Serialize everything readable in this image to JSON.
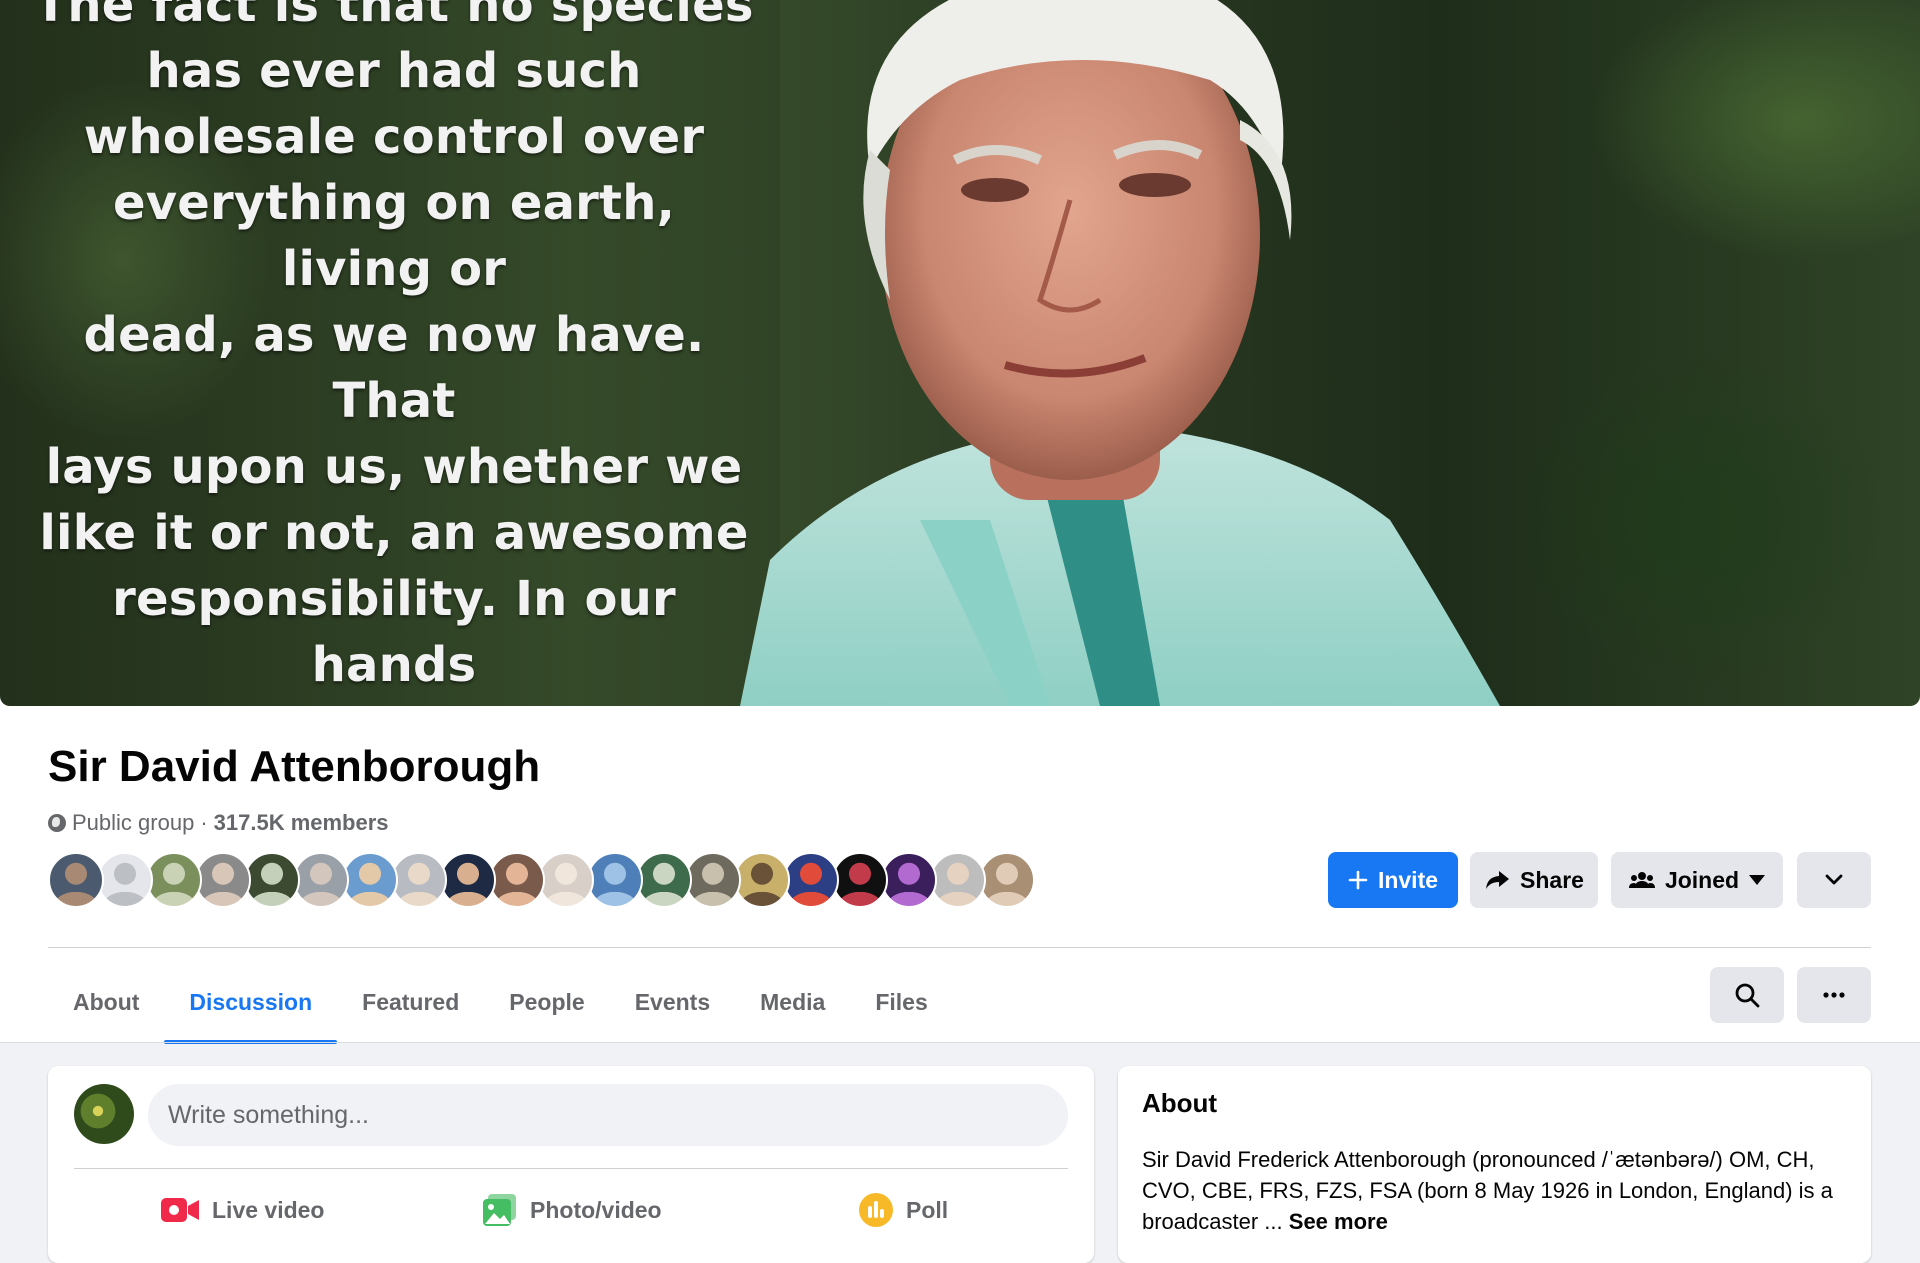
{
  "cover": {
    "quote": "The fact is that no species\nhas ever had such\nwholesale control over\neverything on earth, living or\ndead, as we now have. That\nlays upon us, whether we\nlike it or not, an awesome\nresponsibility. In our hands\nnow lies not only our own\nfuture, but that of all other\nliving creatures with whom\nwe share the earth.\""
  },
  "group": {
    "name": "Sir David Attenborough",
    "privacy": "Public group",
    "separator": "·",
    "members": "317.5K members"
  },
  "member_avatars": [
    {
      "color_a": "#4b5a6e",
      "color_b": "#a88a74"
    },
    {
      "color_a": "#e4e6eb",
      "color_b": "#bcc0c4"
    },
    {
      "color_a": "#7b8f5c",
      "color_b": "#c9d2b4"
    },
    {
      "color_a": "#8a8a8a",
      "color_b": "#d8c7b8"
    },
    {
      "color_a": "#3d4a32",
      "color_b": "#c5d0bb"
    },
    {
      "color_a": "#9aa0a8",
      "color_b": "#d3c6bc"
    },
    {
      "color_a": "#6b9ccf",
      "color_b": "#e3c9a8"
    },
    {
      "color_a": "#b8bcc2",
      "color_b": "#e8d9c8"
    },
    {
      "color_a": "#1e2a44",
      "color_b": "#d8b090"
    },
    {
      "color_a": "#7a5a4a",
      "color_b": "#e3b596"
    },
    {
      "color_a": "#d8d0c8",
      "color_b": "#f0e6dc"
    },
    {
      "color_a": "#4f7fb8",
      "color_b": "#9ec1e6"
    },
    {
      "color_a": "#3e6b4b",
      "color_b": "#cbd6c2"
    },
    {
      "color_a": "#6e6a5e",
      "color_b": "#c8c0ac"
    },
    {
      "color_a": "#c8b06a",
      "color_b": "#6a5238"
    },
    {
      "color_a": "#2c3e84",
      "color_b": "#e04b3a"
    },
    {
      "color_a": "#101010",
      "color_b": "#c23b4b"
    },
    {
      "color_a": "#3a1f5c",
      "color_b": "#b26ad0"
    },
    {
      "color_a": "#bdbdbd",
      "color_b": "#e6d2c0"
    },
    {
      "color_a": "#a98f74",
      "color_b": "#dfcbb6"
    }
  ],
  "actions": {
    "invite": "Invite",
    "share": "Share",
    "joined": "Joined"
  },
  "tabs": [
    "About",
    "Discussion",
    "Featured",
    "People",
    "Events",
    "Media",
    "Files"
  ],
  "active_tab": "Discussion",
  "composer": {
    "placeholder": "Write something...",
    "live_video": "Live video",
    "photo_video": "Photo/video",
    "poll": "Poll"
  },
  "about": {
    "title": "About",
    "description": "Sir David Frederick Attenborough (pronounced /ˈætənbərə/) OM, CH, CVO, CBE, FRS, FZS, FSA (born 8 May 1926 in London, England) is a broadcaster ...",
    "see_more": "See more"
  },
  "colors": {
    "accent": "#1877f2",
    "button_grey": "#e4e6eb",
    "live_red": "#f02849",
    "photo_green": "#45bd62",
    "poll_orange": "#f7b928"
  },
  "icons": [
    "globe-icon",
    "plus-icon",
    "share-arrow-icon",
    "group-people-icon",
    "caret-down-icon",
    "chevron-down-icon",
    "search-icon",
    "more-dots-icon",
    "live-video-icon",
    "photo-icon",
    "poll-icon"
  ]
}
